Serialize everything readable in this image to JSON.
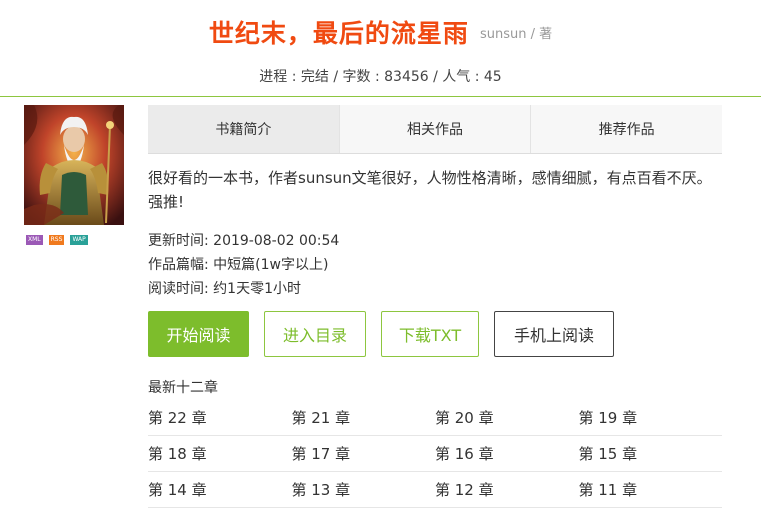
{
  "header": {
    "title": "世纪末，最后的流星雨",
    "author": "sunsun / 著",
    "stats": "进程 : 完结 / 字数 : 83456 / 人气 : 45"
  },
  "cover": {
    "alt": "book-cover"
  },
  "badges": [
    {
      "label": "XML",
      "color": "#9b59b6"
    },
    {
      "label": "RSS",
      "color": "#f07a1e"
    },
    {
      "label": "WAP",
      "color": "#2aa198"
    }
  ],
  "tabs": [
    {
      "label": "书籍简介",
      "active": true
    },
    {
      "label": "相关作品",
      "active": false
    },
    {
      "label": "推荐作品",
      "active": false
    }
  ],
  "description": "很好看的一本书，作者sunsun文笔很好，人物性格清晰，感情细腻，有点百看不厌。强推!",
  "info": {
    "updated": "更新时间:  2019-08-02 00:54",
    "length": "作品篇幅:  中短篇(1w字以上)",
    "read_time": "阅读时间:  约1天零1小时"
  },
  "buttons": {
    "start": "开始阅读",
    "toc": "进入目录",
    "download": "下载TXT",
    "mobile": "手机上阅读"
  },
  "latest": {
    "label": "最新十二章",
    "chapters": [
      [
        "第 22 章",
        "第 21 章",
        "第 20 章",
        "第 19 章"
      ],
      [
        "第 18 章",
        "第 17 章",
        "第 16 章",
        "第 15 章"
      ],
      [
        "第 14 章",
        "第 13 章",
        "第 12 章",
        "第 11 章"
      ]
    ]
  },
  "colors": {
    "title": "#f04a11",
    "accent": "#7dbd2c",
    "divider": "#8dc63f"
  }
}
